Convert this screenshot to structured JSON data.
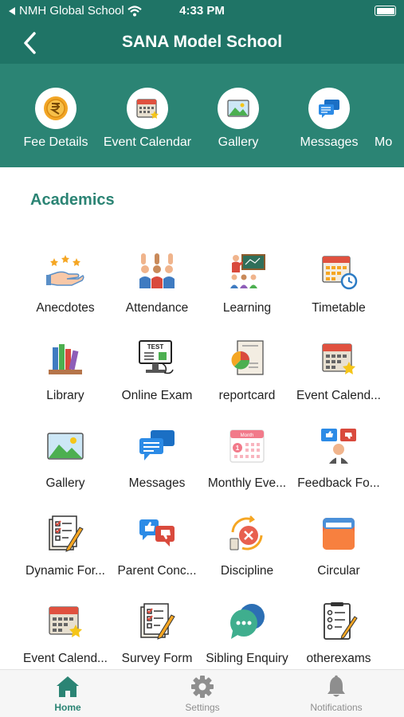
{
  "status": {
    "carrier": "NMH Global School",
    "time": "4:33 PM"
  },
  "header": {
    "title": "SANA Model School"
  },
  "quick_links": [
    {
      "label": "Fee Details",
      "icon": "rupee-coin-icon"
    },
    {
      "label": "Event Calendar",
      "icon": "calendar-star-icon"
    },
    {
      "label": "Gallery",
      "icon": "picture-icon"
    },
    {
      "label": "Messages",
      "icon": "chat-bubbles-icon"
    },
    {
      "label": "Mo",
      "icon": ""
    }
  ],
  "section": {
    "title": "Academics"
  },
  "modules": [
    {
      "label": "Anecdotes",
      "icon": "hand-stars-icon"
    },
    {
      "label": "Attendance",
      "icon": "raised-hands-icon"
    },
    {
      "label": "Learning",
      "icon": "teacher-board-icon"
    },
    {
      "label": "Timetable",
      "icon": "calendar-clock-icon"
    },
    {
      "label": "Library",
      "icon": "books-icon"
    },
    {
      "label": "Online Exam",
      "icon": "test-monitor-icon"
    },
    {
      "label": "reportcard",
      "icon": "report-chart-icon"
    },
    {
      "label": "Event Calend...",
      "icon": "calendar-star-icon"
    },
    {
      "label": "Gallery",
      "icon": "picture-icon"
    },
    {
      "label": "Messages",
      "icon": "chat-bubbles-icon"
    },
    {
      "label": "Monthly Eve...",
      "icon": "month-calendar-icon"
    },
    {
      "label": "Feedback Fo...",
      "icon": "feedback-icon"
    },
    {
      "label": "Dynamic For...",
      "icon": "checklist-pen-icon"
    },
    {
      "label": "Parent Conc...",
      "icon": "thumbs-chat-icon"
    },
    {
      "label": "Discipline",
      "icon": "discipline-icon"
    },
    {
      "label": "Circular",
      "icon": "folder-icon"
    },
    {
      "label": "Event Calend...",
      "icon": "calendar-star-icon"
    },
    {
      "label": "Survey Form",
      "icon": "checklist-pen-icon"
    },
    {
      "label": "Sibling Enquiry",
      "icon": "chat-dots-icon"
    },
    {
      "label": "otherexams",
      "icon": "exam-paper-icon"
    }
  ],
  "tabs": [
    {
      "label": "Home",
      "icon": "home-icon",
      "active": true
    },
    {
      "label": "Settings",
      "icon": "gear-icon",
      "active": false
    },
    {
      "label": "Notifications",
      "icon": "bell-icon",
      "active": false
    }
  ],
  "colors": {
    "header": "#1f7466",
    "strip": "#2b8474",
    "accent": "#2b8474"
  }
}
